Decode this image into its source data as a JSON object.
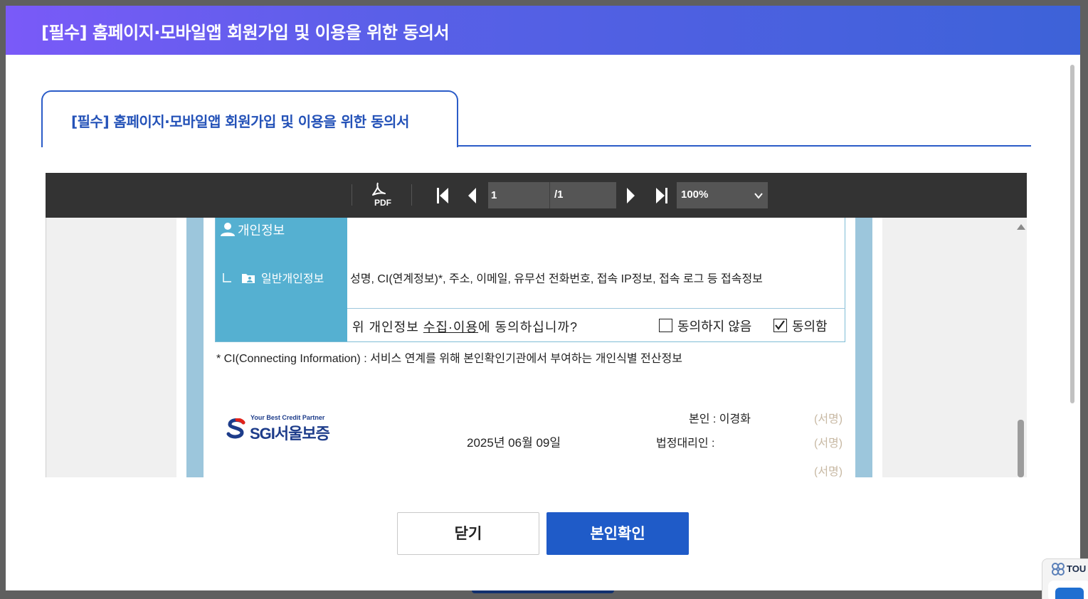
{
  "modal": {
    "title": "[필수] 홈페이지·모바일앱 회원가입 및 이용을 위한 동의서"
  },
  "tab": {
    "label": "[필수] 홈페이지·모바일앱 회원가입 및 이용을 위한 동의서"
  },
  "viewer": {
    "pdf_label": "PDF",
    "page_current": "1",
    "page_total": "/1",
    "zoom": "100%"
  },
  "document": {
    "category_title": "개인정보",
    "category_sub": "일반개인정보",
    "fields_text": "성명, CI(연계정보)*, 주소, 이메일, 유무선 전화번호, 접속 IP정보, 접속 로그 등 접속정보",
    "question_prefix": "위 개인정보 ",
    "question_underline": "수집·이용",
    "question_suffix": "에 동의하십니까?",
    "disagree_label": "동의하지 않음",
    "agree_label": "동의함",
    "disagree_checked": false,
    "agree_checked": true,
    "footnote": "* CI(Connecting Information) : 서비스 연계를 위해 본인확인기관에서 부여하는 개인식별 전산정보",
    "logo_tagline": "Your Best Credit Partner",
    "logo_brand": "SGI서울보증",
    "date": "2025년  06월  09일",
    "self_label": "본인 : 이경화",
    "agent_label": "법정대리인 :",
    "sign_mark_1": "(서명)",
    "sign_mark_2": "(서명)",
    "sign_mark_3": "(서명)"
  },
  "buttons": {
    "close": "닫기",
    "confirm": "본인확인"
  },
  "widget": {
    "text": "TOU"
  },
  "colors": {
    "header_gradient_start": "#7a5af8",
    "header_gradient_end": "#3d62d8",
    "accent_blue": "#2b5cc8",
    "confirm_button": "#1f5bc8",
    "category_cell": "#55b0d1",
    "side_band": "#9cc6dc",
    "toolbar": "#333333"
  },
  "icons": {
    "pdf": "pdf-icon",
    "first_page": "first-page-icon",
    "prev_page": "prev-page-icon",
    "next_page": "next-page-icon",
    "last_page": "last-page-icon",
    "zoom_dropdown": "chevron-down-icon",
    "person": "person-icon",
    "folder_person": "folder-person-icon",
    "scroll_up": "scroll-up-arrow-icon"
  }
}
